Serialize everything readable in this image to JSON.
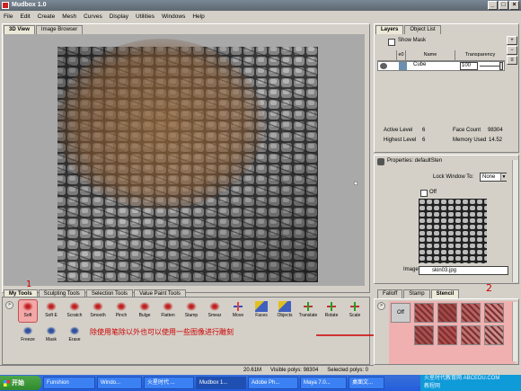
{
  "window": {
    "title": "Mudbox 1.0"
  },
  "menu": [
    "File",
    "Edit",
    "Create",
    "Mesh",
    "Curves",
    "Display",
    "Utilities",
    "Windows",
    "Help"
  ],
  "view_tabs": [
    "3D View",
    "Image Browser"
  ],
  "right_tabs": [
    "Layers",
    "Object List"
  ],
  "layers": {
    "show_mask": "Show Mask",
    "col_name": "Name",
    "col_transparency": "Transparency",
    "col_vis": "e0",
    "layer_name": "Cube",
    "transparency_value": "100",
    "active_level_label": "Active Level",
    "active_level": "6",
    "face_count_label": "Face Count",
    "face_count": "98304",
    "highest_level_label": "Highest Level",
    "highest_level": "6",
    "memory_label": "Memory Used",
    "memory": "14.52"
  },
  "properties": {
    "title": "Properties: defaultSten",
    "lock_label": "Lock Window To:",
    "lock_value": "None",
    "off_label": "Off",
    "image_label": "Image",
    "image_value": "skin03.jpg"
  },
  "tool_tabs": [
    "My Tools",
    "Sculpting Tools",
    "Selection Tools",
    "Value Paint Tools"
  ],
  "tools_row1": [
    "Soft",
    "Soft E",
    "Scratch",
    "Smooth",
    "Pinch",
    "Bulge",
    "Flatten",
    "Stamp",
    "Smear",
    "Move",
    "Faces",
    "Objects",
    "Translate",
    "Rotate",
    "Scale"
  ],
  "tools_row2": [
    "Freeze",
    "Mask",
    "Erase"
  ],
  "stencil_tabs": [
    "Falloff",
    "Stamp",
    "Stencil"
  ],
  "stencil_off": "Off",
  "annotations": {
    "one": "1",
    "two": "2",
    "note": "除使用笔除以外也可以使用一些图像进行雕刻"
  },
  "status": {
    "mem": "20.61M",
    "visible": "Visible polys: 98304",
    "selected": "Selected polys: 0"
  },
  "taskbar": {
    "start": "开始",
    "tasks": [
      "Funshion",
      "Windo...",
      "火星时代 ...",
      "Mudbox 1...",
      "Adobe Ph...",
      "Maya 7.0...",
      "桌面文..."
    ],
    "watermark": "火星时代教育网 ABCEDU.COM",
    "watermark2": "教程网"
  },
  "colors": {
    "accent": "#245edb",
    "annotation": "#cc0000",
    "highlight": "#f3b0b0"
  }
}
